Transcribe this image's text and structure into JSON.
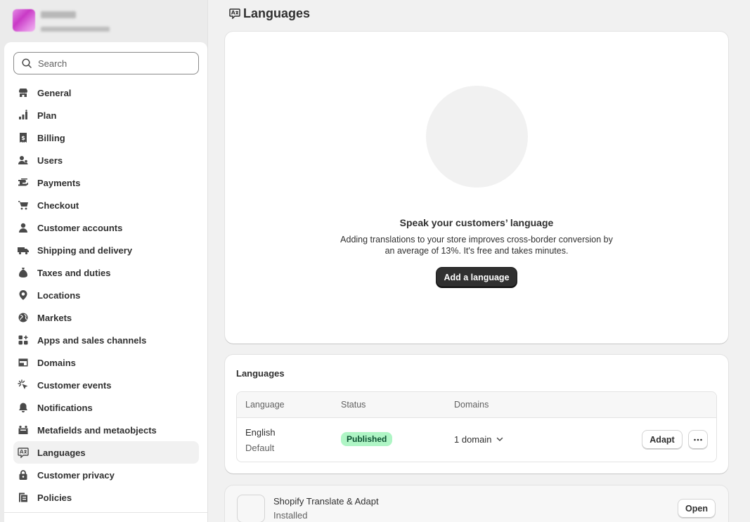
{
  "sidebar": {
    "search_placeholder": "Search",
    "items": [
      {
        "label": "General",
        "icon": "store-icon"
      },
      {
        "label": "Plan",
        "icon": "plan-chart-icon"
      },
      {
        "label": "Billing",
        "icon": "billing-receipt-icon"
      },
      {
        "label": "Users",
        "icon": "users-icon"
      },
      {
        "label": "Payments",
        "icon": "payments-hand-icon"
      },
      {
        "label": "Checkout",
        "icon": "cart-icon"
      },
      {
        "label": "Customer accounts",
        "icon": "person-icon"
      },
      {
        "label": "Shipping and delivery",
        "icon": "truck-icon"
      },
      {
        "label": "Taxes and duties",
        "icon": "tax-bag-icon"
      },
      {
        "label": "Locations",
        "icon": "location-pin-icon"
      },
      {
        "label": "Markets",
        "icon": "globe-icon"
      },
      {
        "label": "Apps and sales channels",
        "icon": "apps-icon"
      },
      {
        "label": "Domains",
        "icon": "domains-icon"
      },
      {
        "label": "Customer events",
        "icon": "cursor-click-icon"
      },
      {
        "label": "Notifications",
        "icon": "bell-icon"
      },
      {
        "label": "Metafields and metaobjects",
        "icon": "metafields-icon"
      },
      {
        "label": "Languages",
        "icon": "language-icon"
      },
      {
        "label": "Customer privacy",
        "icon": "lock-icon"
      },
      {
        "label": "Policies",
        "icon": "policy-document-icon"
      }
    ],
    "active_item": "Languages"
  },
  "page": {
    "title": "Languages",
    "title_icon": "language-icon"
  },
  "hero": {
    "title": "Speak your customers’ language",
    "description": "Adding translations to your store improves cross-border conversion by an average of 13%. It's free and takes minutes.",
    "button_label": "Add a language"
  },
  "languages_card": {
    "title": "Languages",
    "columns": [
      "Language",
      "Status",
      "Domains"
    ],
    "rows": [
      {
        "language": "English",
        "note": "Default",
        "status": "Published",
        "domains": "1 domain",
        "action_label": "Adapt"
      }
    ]
  },
  "app_card": {
    "name": "Shopify Translate & Adapt",
    "status": "Installed",
    "button_label": "Open"
  },
  "colors": {
    "primary_button": "#303030",
    "badge_success_bg": "#aff5c5",
    "badge_success_text": "#0c5132",
    "sidebar_bg": "#ebebeb",
    "page_bg": "#f1f1f1"
  }
}
